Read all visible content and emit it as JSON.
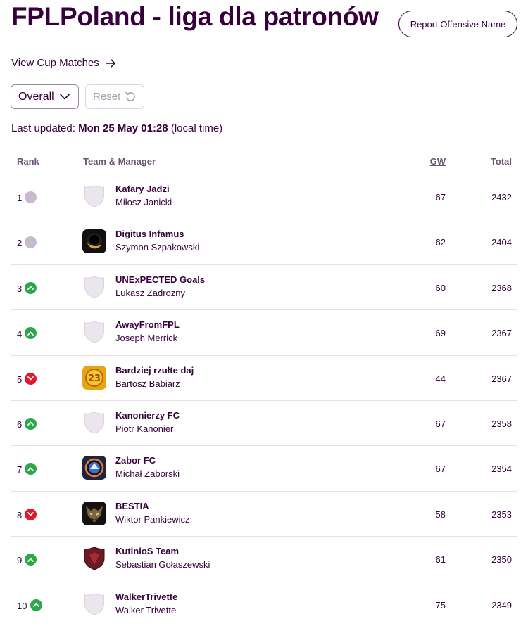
{
  "header": {
    "title": "FPLPoland - liga dla patronów",
    "report_label": "Report Offensive Name"
  },
  "cup_link": {
    "label": "View Cup Matches",
    "icon": "arrow-right-icon"
  },
  "filters": {
    "phase_value": "Overall",
    "reset_label": "Reset"
  },
  "updated": {
    "prefix": "Last updated:",
    "value": "Mon 25 May 01:28",
    "suffix": "(local time)"
  },
  "table": {
    "headers": {
      "rank": "Rank",
      "team": "Team & Manager",
      "gw": "GW",
      "total": "Total"
    },
    "colors": {
      "same": "#c9b9ce",
      "up": "#2aa84a",
      "down": "#e0192d",
      "primary": "#37003c"
    },
    "rows": [
      {
        "rank": "1",
        "movement": "same",
        "crest": "shield-placeholder",
        "team": "Kafary Jadzi",
        "manager": "Miłosz Janicki",
        "gw": "67",
        "total": "2432"
      },
      {
        "rank": "2",
        "movement": "same",
        "crest": "dark-orb-avatar",
        "team": "Digitus Infamus",
        "manager": "Szymon Szpakowski",
        "gw": "62",
        "total": "2404"
      },
      {
        "rank": "3",
        "movement": "up",
        "crest": "shield-placeholder",
        "team": "UNExPECTED Goals",
        "manager": "Lukasz Zadrozny",
        "gw": "60",
        "total": "2368"
      },
      {
        "rank": "4",
        "movement": "up",
        "crest": "shield-placeholder",
        "team": "AwayFromFPL",
        "manager": "Joseph Merrick",
        "gw": "69",
        "total": "2367"
      },
      {
        "rank": "5",
        "movement": "down",
        "crest": "gold-emblem-avatar",
        "team": "Bardziej rzułte daj",
        "manager": "Bartosz Babiarz",
        "gw": "44",
        "total": "2367"
      },
      {
        "rank": "6",
        "movement": "up",
        "crest": "shield-placeholder",
        "team": "Kanonierzy FC",
        "manager": "Piotr Kanonier",
        "gw": "67",
        "total": "2358"
      },
      {
        "rank": "7",
        "movement": "up",
        "crest": "blue-badge-avatar",
        "team": "Zabor FC",
        "manager": "Michał Zaborski",
        "gw": "67",
        "total": "2354"
      },
      {
        "rank": "8",
        "movement": "down",
        "crest": "beast-avatar",
        "team": "BESTIA",
        "manager": "Wiktor Pankiewicz",
        "gw": "58",
        "total": "2353"
      },
      {
        "rank": "9",
        "movement": "up",
        "crest": "maroon-shield-avatar",
        "team": "KutinioS Team",
        "manager": "Sebastian Gołaszewski",
        "gw": "61",
        "total": "2350"
      },
      {
        "rank": "10",
        "movement": "up",
        "crest": "shield-placeholder",
        "team": "WalkerTrivette",
        "manager": "Walker Trivette",
        "gw": "75",
        "total": "2349"
      }
    ]
  }
}
